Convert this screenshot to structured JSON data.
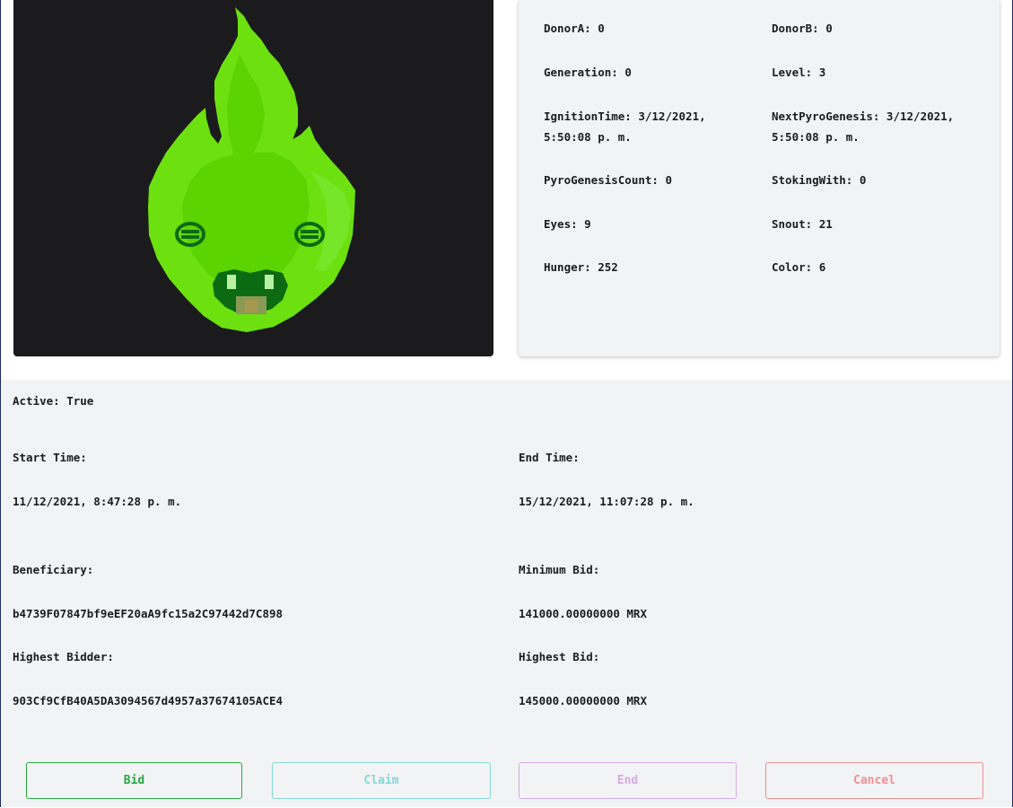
{
  "attributes": [
    {
      "label": "DonorA",
      "value": "0"
    },
    {
      "label": "DonorB",
      "value": "0"
    },
    {
      "label": "Generation",
      "value": "0"
    },
    {
      "label": "Level",
      "value": "3"
    },
    {
      "label": "IgnitionTime",
      "value": "3/12/2021, 5:50:08 p. m.",
      "line1": "IgnitionTime: 3/12/2021,",
      "line2": "5:50:08 p. m."
    },
    {
      "label": "NextPyroGenesis",
      "value": "3/12/2021, 5:50:08 p. m.",
      "line1": "NextPyroGenesis: 3/12/2021,",
      "line2": "5:50:08 p. m."
    },
    {
      "label": "PyroGenesisCount",
      "value": "0"
    },
    {
      "label": "StokingWith",
      "value": "0"
    },
    {
      "label": "Eyes",
      "value": "9"
    },
    {
      "label": "Snout",
      "value": "21"
    },
    {
      "label": "Hunger",
      "value": "252"
    },
    {
      "label": "Color",
      "value": "6"
    }
  ],
  "auction": {
    "active_label": "Active:",
    "active_value": "True",
    "start_time_label": "Start Time:",
    "start_time": "11/12/2021, 8:47:28 p. m.",
    "end_time_label": "End Time:",
    "end_time": "15/12/2021, 11:07:28 p. m.",
    "beneficiary_label": "Beneficiary:",
    "beneficiary": "b4739F07847bf9eEF20aA9fc15a2C97442d7C898",
    "minimum_bid_label": "Minimum Bid:",
    "minimum_bid": "141000.00000000 MRX",
    "highest_bidder_label": "Highest Bidder:",
    "highest_bidder": "903Cf9CfB40A5DA3094567d4957a37674105ACE4",
    "highest_bid_label": "Highest Bid:",
    "highest_bid": "145000.00000000 MRX"
  },
  "actions": {
    "bid": "Bid",
    "claim": "Claim",
    "end": "End",
    "cancel": "Cancel"
  },
  "colors": {
    "bid": "#27a844",
    "claim": "#86d7d5",
    "end": "#d7a9e2",
    "cancel": "#ec9094",
    "flame_outer": "#6be10c",
    "flame_inner": "#5cd400",
    "flame_dark": "#0c6a12"
  }
}
